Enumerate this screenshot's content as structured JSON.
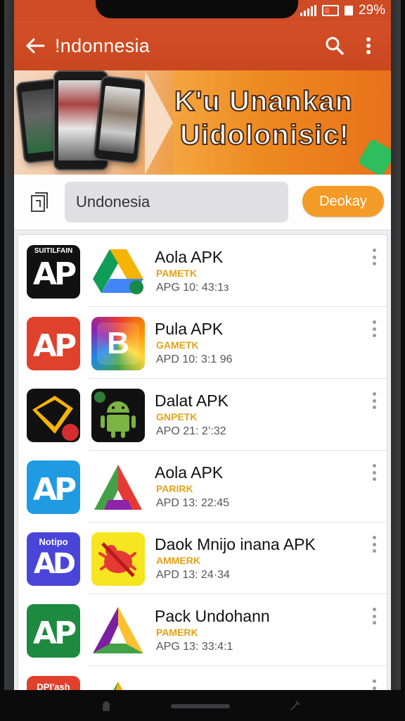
{
  "status_bar": {
    "battery_percent": "29%"
  },
  "app_bar": {
    "title": "!ndonnesia"
  },
  "banner": {
    "line1": "K'u Unankan",
    "line2": "Uidolonisic!"
  },
  "search": {
    "value": "Undonesia",
    "button_label": "Deokay"
  },
  "apps": [
    {
      "logo_top": "SUITILFAIN",
      "logo_text": "AP",
      "logo_color": "#111111",
      "icon": "drive-like-icon",
      "name": "Aola APK",
      "category": "PAMETK",
      "date": "APG 10: 43:1з"
    },
    {
      "logo_top": "",
      "logo_text": "AP",
      "logo_color": "#e0412a",
      "icon": "rainbow-r-icon",
      "name": "Pula APK",
      "category": "GAMETK",
      "date": "APD 10: 3:1 96"
    },
    {
      "logo_top": "",
      "logo_text": "✉",
      "logo_color": "#111111",
      "icon": "android-icon",
      "name": "Dalat APK",
      "category": "GNPETK",
      "date": "APO 21: 2’:32"
    },
    {
      "logo_top": "",
      "logo_text": "AP",
      "logo_color": "#1f9be3",
      "icon": "triangle-icon",
      "name": "Aola APK",
      "category": "PARIRK",
      "date": "APD 13: 22:45"
    },
    {
      "logo_top": "Notipo",
      "logo_text": "AD",
      "logo_color": "#4a45d9",
      "icon": "bug-icon",
      "name": "Daok Mnijo inana APK",
      "category": "AMMERK",
      "date": "APD 13: 24·34"
    },
    {
      "logo_top": "",
      "logo_text": "AP",
      "logo_color": "#1e8a3f",
      "icon": "triangle-multi-icon",
      "name": "Pack Undohann",
      "category": "PAMERK",
      "date": "APG 13: 33:4:1"
    },
    {
      "logo_top": "DPI'ash",
      "logo_text": "",
      "logo_color": "#e0412a",
      "icon": "triangle-partial-icon",
      "name": "",
      "category": "",
      "date": ""
    }
  ],
  "colors": {
    "accent": "#ce4b25",
    "button": "#f39b26",
    "category": "#e0a21a"
  }
}
